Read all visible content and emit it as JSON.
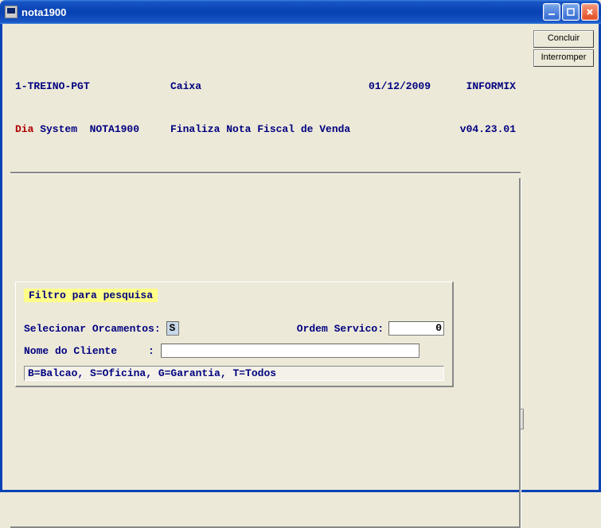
{
  "window": {
    "title": "nota1900"
  },
  "sidebar": {
    "concluir": "Concluir",
    "interromper": "Interromper"
  },
  "header": {
    "col1a": "1-TREINO-PGT",
    "col2a": "Caixa",
    "col3a": "01/12/2009",
    "col4a": "INFORMIX",
    "dia": "Dia",
    "system_prog": " System  NOTA1900",
    "col2b": "Finaliza Nota Fiscal de Venda",
    "col4b": "v04.23.01"
  },
  "filter": {
    "title": "Filtro para pesquisa",
    "selecionar_label": "Selecionar Orcamentos: ",
    "selecionar_value": "S",
    "ordem_label": "Ordem Servico:",
    "ordem_value": "0",
    "nome_label": "Nome do Cliente     : ",
    "nome_value": "",
    "hint": "B=Balcao, S=Oficina, G=Garantia, T=Todos"
  }
}
